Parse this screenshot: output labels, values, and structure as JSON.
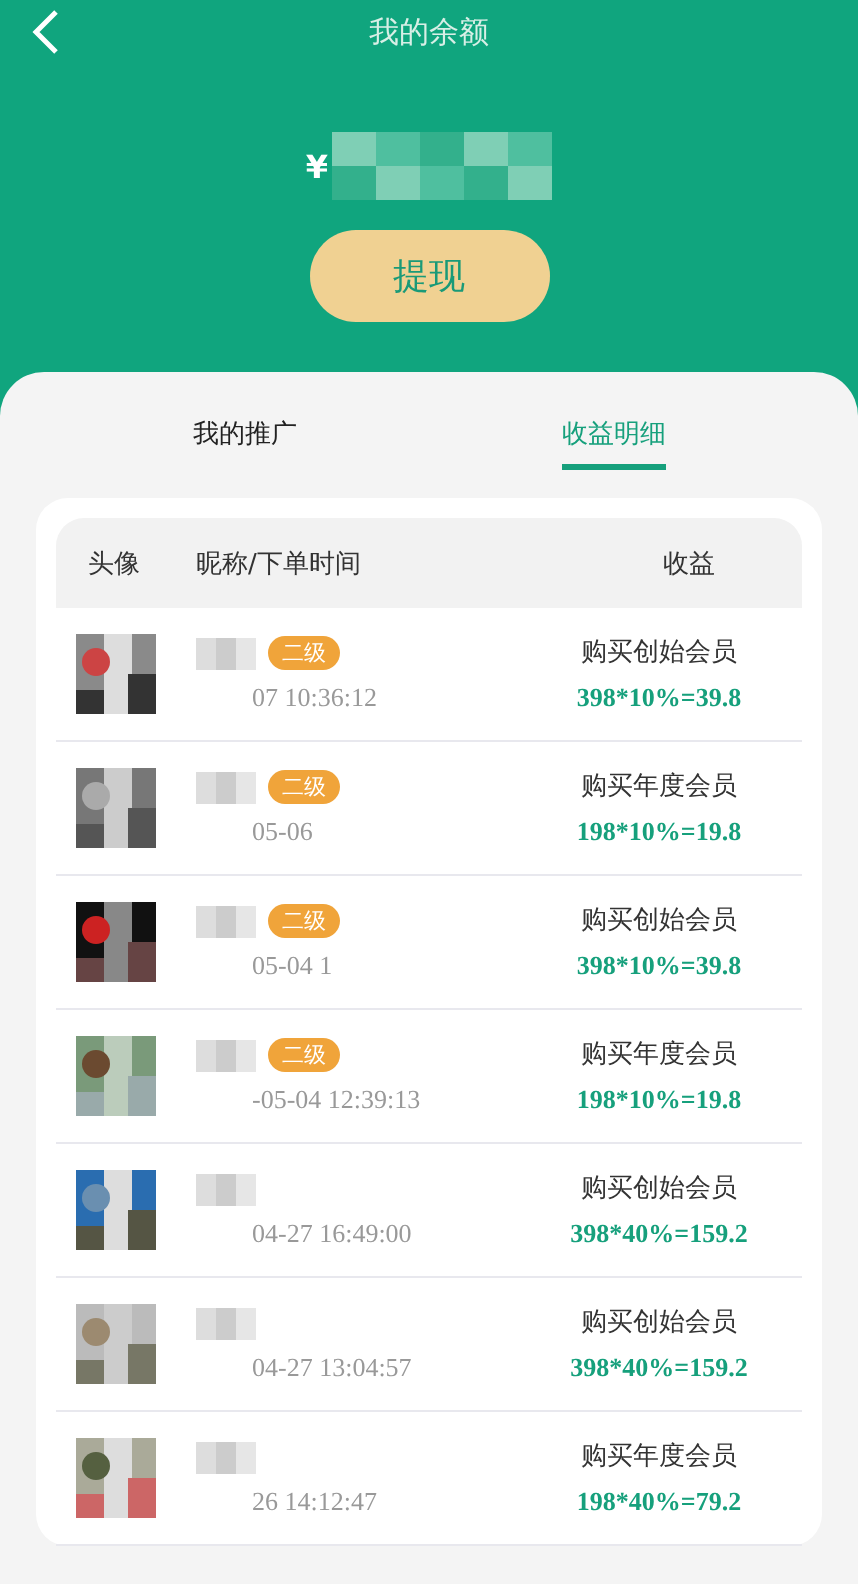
{
  "header": {
    "title": "我的余额",
    "balance": "¥",
    "withdraw_button": "提现"
  },
  "tabs": [
    {
      "label": "我的推广",
      "selected": false
    },
    {
      "label": "收益明细",
      "selected": true
    }
  ],
  "table": {
    "columns": [
      "头像",
      "昵称/下单时间",
      "收益"
    ],
    "rows": [
      {
        "badge": "二级",
        "time": "07 10:36:12",
        "item": "购买创始会员",
        "earning": "398*10%=39.8"
      },
      {
        "badge": "二级",
        "time": "05-06",
        "item": "购买年度会员",
        "earning": "198*10%=19.8"
      },
      {
        "badge": "二级",
        "time": "05-04 1",
        "item": "购买创始会员",
        "earning": "398*10%=39.8"
      },
      {
        "badge": "二级",
        "time": "-05-04 12:39:13",
        "item": "购买年度会员",
        "earning": "198*10%=19.8"
      },
      {
        "time": "04-27 16:49:00",
        "item": "购买创始会员",
        "earning": "398*40%=159.2"
      },
      {
        "time": "04-27 13:04:57",
        "item": "购买创始会员",
        "earning": "398*40%=159.2"
      },
      {
        "time": "26 14:12:47",
        "item": "购买年度会员",
        "earning": "198*40%=79.2"
      }
    ]
  }
}
